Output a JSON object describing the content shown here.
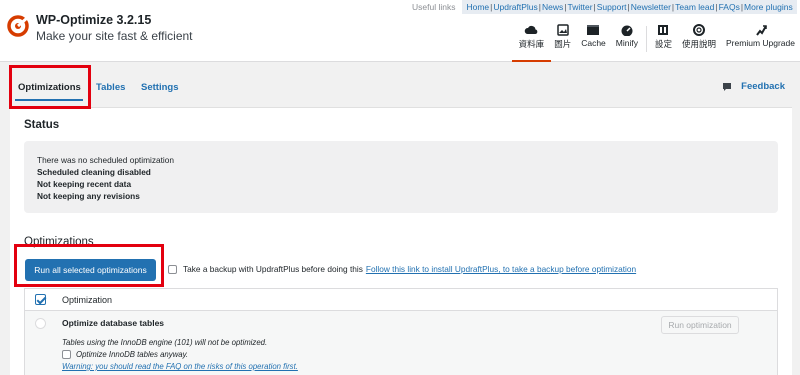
{
  "header": {
    "brand_name": "WP-Optimize 3.2.15",
    "tagline": "Make your site fast & efficient",
    "useful_links_label": "Useful links",
    "useful_links": [
      "Home",
      "UpdraftPlus",
      "News",
      "Twitter",
      "Support",
      "Newsletter",
      "Team lead",
      "FAQs",
      "More plugins"
    ],
    "nav": [
      {
        "label": "資料庫",
        "icon": "cloud-icon",
        "active": true
      },
      {
        "label": "圖片",
        "icon": "images-icon"
      },
      {
        "label": "Cache",
        "icon": "cache-icon"
      },
      {
        "label": "Minify",
        "icon": "dashboard-icon"
      },
      {
        "label": "設定",
        "icon": "settings-icon"
      },
      {
        "label": "使用說明",
        "icon": "help-icon"
      },
      {
        "label": "Premium Upgrade",
        "icon": "upgrade-icon"
      }
    ]
  },
  "tabs": {
    "optimizations": "Optimizations",
    "tables": "Tables",
    "settings": "Settings",
    "feedback": "Feedback"
  },
  "status": {
    "title": "Status",
    "lines": [
      "There was no scheduled optimization",
      "Scheduled cleaning disabled",
      "Not keeping recent data",
      "Not keeping any revisions"
    ]
  },
  "optimizations": {
    "title": "Optimizations",
    "run_all_label": "Run all selected optimizations",
    "backup_label": "Take a backup with UpdraftPlus before doing this",
    "backup_link": "Follow this link to install UpdraftPlus, to take a backup before optimization",
    "table_header": "Optimization",
    "rows": [
      {
        "title": "Optimize database tables",
        "note": "Tables using the InnoDB engine (101) will not be optimized.",
        "checkbox_label": "Optimize InnoDB tables anyway.",
        "warning": "Warning: you should read the FAQ on the risks of this operation first.",
        "button": "Run optimization"
      }
    ]
  },
  "colors": {
    "accent": "#2271b1",
    "brand_orange": "#d63c00",
    "highlight_red": "#e3000f"
  }
}
